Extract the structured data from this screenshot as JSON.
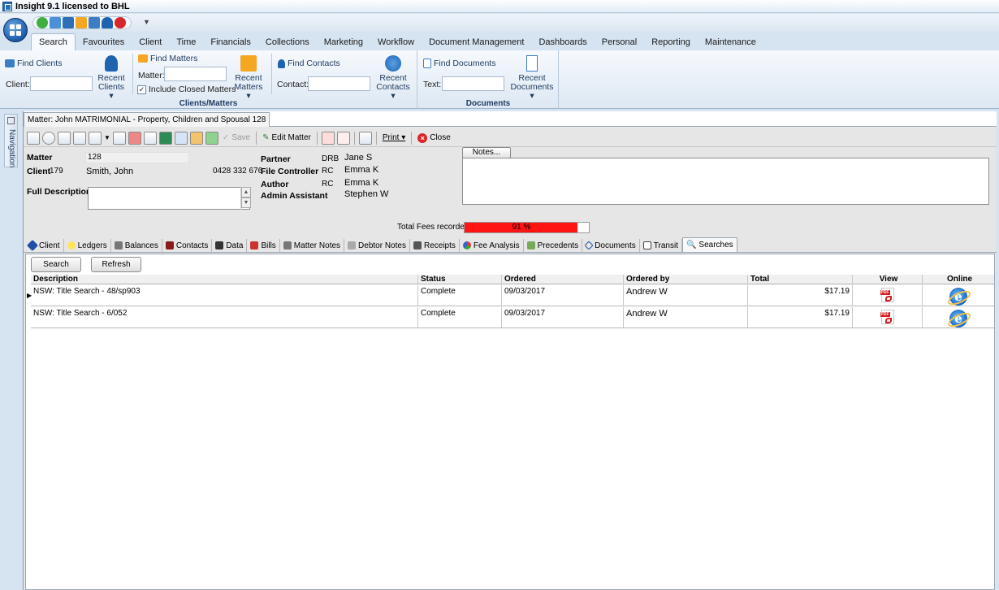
{
  "window": {
    "title": "Insight 9.1 licensed to BHL"
  },
  "ribbon_tabs": [
    "Search",
    "Favourites",
    "Client",
    "Time",
    "Financials",
    "Collections",
    "Marketing",
    "Workflow",
    "Document Management",
    "Dashboards",
    "Personal",
    "Reporting",
    "Maintenance"
  ],
  "ribbon": {
    "find_clients": "Find Clients",
    "client_label": "Client:",
    "recent_clients": "Recent Clients ▾",
    "find_matters": "Find Matters",
    "matter_label": "Matter:",
    "include_closed": "Include Closed Matters",
    "recent_matters": "Recent Matters ▾",
    "find_contacts": "Find Contacts",
    "contact_label": "Contact:",
    "recent_contacts": "Recent Contacts ▾",
    "group_clients_matters": "Clients/Matters",
    "find_documents": "Find Documents",
    "text_label": "Text:",
    "recent_documents": "Recent Documents ▾",
    "group_documents": "Documents"
  },
  "navigation_label": "Navigation",
  "doc_tab": "Matter: John MATRIMONIAL - Property, Children and Spousal 128",
  "toolbar": {
    "save": "Save",
    "edit_matter": "Edit Matter",
    "print": "Print ▾",
    "close": "Close"
  },
  "matter": {
    "matter_label": "Matter",
    "matter_no": "128",
    "client_label": "Client",
    "client_no": "179",
    "client_name": "Smith, John",
    "phone": "0428 332 676",
    "full_description_label": "Full Description",
    "staff": [
      {
        "role": "Partner",
        "code": "DRB",
        "name": "Jane S"
      },
      {
        "role": "File Controller",
        "code": "RC",
        "name": "Emma K"
      },
      {
        "role": "Author",
        "code": "RC",
        "name": "Emma K"
      },
      {
        "role": "Admin Assistant",
        "code": "",
        "name": "Stephen W"
      }
    ],
    "notes_button": "Notes...",
    "fees_label": "Total Fees  recorded",
    "fees_percent_text": "91 %",
    "fees_fraction": 0.91
  },
  "matter_tabs": [
    "Client",
    "Ledgers",
    "Balances",
    "Contacts",
    "Data",
    "Bills",
    "Matter Notes",
    "Debtor Notes",
    "Receipts",
    "Fee Analysis",
    "Precedents",
    "Documents",
    "Transit",
    "Searches"
  ],
  "searches": {
    "search_button": "Search",
    "refresh_button": "Refresh",
    "columns": [
      "Description",
      "Status",
      "Ordered",
      "Ordered by",
      "Total",
      "View",
      "Online"
    ],
    "rows": [
      {
        "description": "NSW: Title Search - 48/sp903",
        "status": "Complete",
        "ordered": "09/03/2017",
        "ordered_by": "Andrew W",
        "total": "$17.19"
      },
      {
        "description": "NSW: Title Search - 6/052",
        "status": "Complete",
        "ordered": "09/03/2017",
        "ordered_by": "Andrew W",
        "total": "$17.19"
      }
    ]
  },
  "colors": {
    "accent": "#2b6fb6",
    "fees_bar": "#ff1414",
    "ribbon_bg": "#dde8f3"
  }
}
